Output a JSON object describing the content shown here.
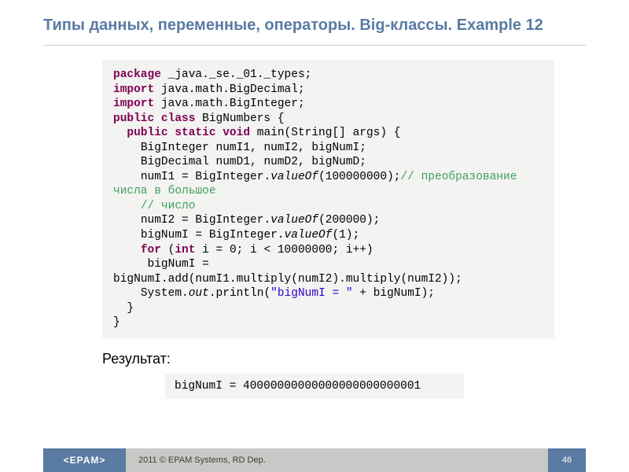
{
  "title": "Типы данных, переменные, операторы. Big-классы. Example 12",
  "code": {
    "l1a": "package",
    "l1b": " _java._se._01._types;",
    "l2a": "import",
    "l2b": " java.math.BigDecimal;",
    "l3a": "import",
    "l3b": " java.math.BigInteger;",
    "l4a": "public class",
    "l4b": " BigNumbers {",
    "l5pad": "  ",
    "l5a": "public static void",
    "l5b": " main(String[] args) {",
    "l6": "    BigInteger numI1, numI2, bigNumI;",
    "l7": "    BigDecimal numD1, numD2, bigNumD;",
    "l8a": "    numI1 = BigInteger.",
    "l8m": "valueOf",
    "l8b": "(100000000);",
    "l8c": "// преобразование числа в большое",
    "l9pad": "    ",
    "l9c": "// число",
    "l10a": "    numI2 = BigInteger.",
    "l10m": "valueOf",
    "l10b": "(200000);",
    "l11a": "    bigNumI = BigInteger.",
    "l11m": "valueOf",
    "l11b": "(1);",
    "l12pad": "    ",
    "l12a": "for",
    "l12b": " (",
    "l12c": "int",
    "l12d": " i = 0; i < 10000000; i++)",
    "l13": "     bigNumI = bigNumI.add(numI1.multiply(numI2).multiply(numI2));",
    "l14a": "    System.",
    "l14m": "out",
    "l14b": ".println(",
    "l14s": "\"bigNumI = \"",
    "l14c": " + bigNumI);",
    "l15": "  }",
    "l16": "}"
  },
  "result_label": "Результат:",
  "result_value": "bigNumI = 40000000000000000000000001",
  "footer": {
    "logo": "<EPAM>",
    "copyright": "2011 © EPAM Systems, RD Dep.",
    "page": "46"
  }
}
